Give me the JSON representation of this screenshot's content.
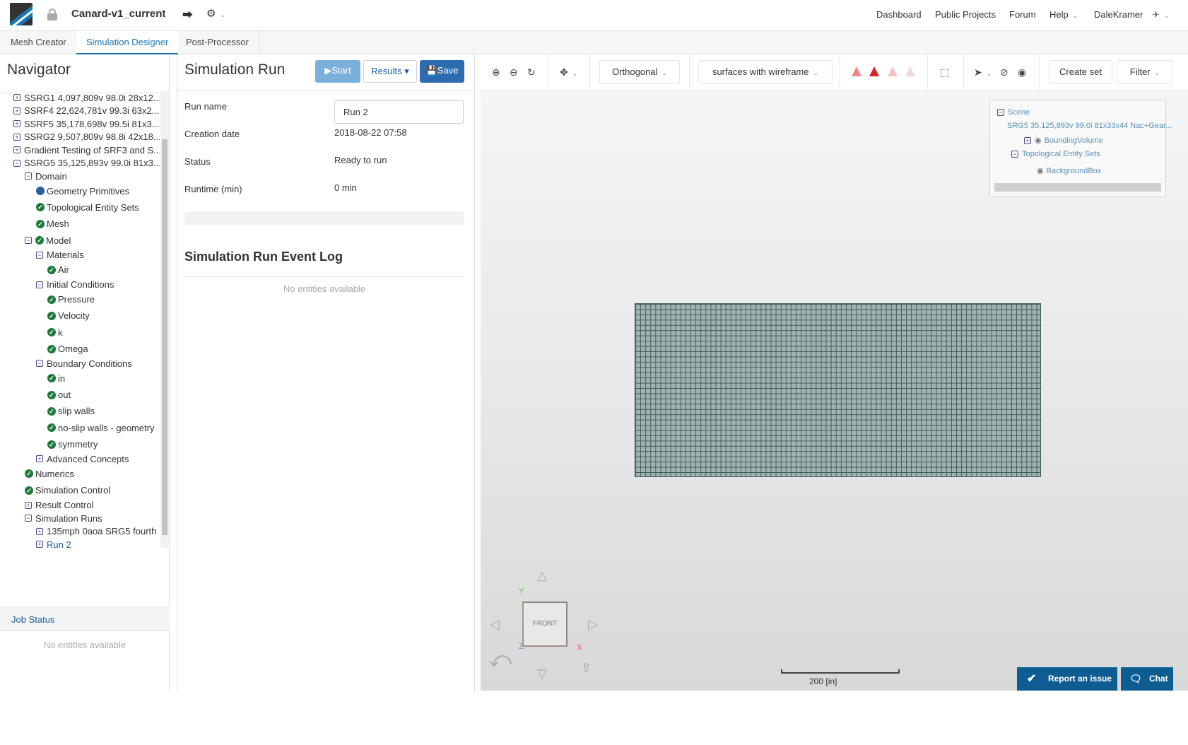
{
  "header": {
    "project_title": "Canard-v1_current",
    "nav": [
      "Dashboard",
      "Public Projects",
      "Forum",
      "Help",
      "DaleKramer"
    ]
  },
  "tabs": [
    "Mesh Creator",
    "Simulation Designer",
    "Post-Processor"
  ],
  "navigator": {
    "title": "Navigator",
    "tree": [
      {
        "label": "SSRG1 4,097,809v 98.0i 28x12...",
        "level": 0,
        "toggle": "+"
      },
      {
        "label": "SSRF4 22,624,781v 99.3i 63x2...",
        "level": 0,
        "toggle": "+"
      },
      {
        "label": "SSRF5 35,178,698v 99.5i 81x3...",
        "level": 0,
        "toggle": "+"
      },
      {
        "label": "SSRG2 9,507,809v 98.8i 42x18...",
        "level": 0,
        "toggle": "+"
      },
      {
        "label": "Gradient Testing of SRF3 and S...",
        "level": 0,
        "toggle": "+"
      },
      {
        "label": "SSRG5 35,125,893v 99.0i 81x3...",
        "level": 0,
        "toggle": "-"
      },
      {
        "label": "Domain",
        "level": 1,
        "toggle": "-"
      },
      {
        "label": "Geometry Primitives",
        "level": 2,
        "icon": "dot"
      },
      {
        "label": "Topological Entity Sets",
        "level": 2,
        "icon": "check"
      },
      {
        "label": "Mesh",
        "level": 2,
        "icon": "check"
      },
      {
        "label": "Model",
        "level": 1,
        "toggle": "-",
        "icon": "check"
      },
      {
        "label": "Materials",
        "level": 2,
        "toggle": "-"
      },
      {
        "label": "Air",
        "level": 3,
        "icon": "check"
      },
      {
        "label": "Initial Conditions",
        "level": 2,
        "toggle": "-"
      },
      {
        "label": "Pressure",
        "level": 3,
        "icon": "check"
      },
      {
        "label": "Velocity",
        "level": 3,
        "icon": "check"
      },
      {
        "label": "k",
        "level": 3,
        "icon": "check"
      },
      {
        "label": "Omega",
        "level": 3,
        "icon": "check"
      },
      {
        "label": "Boundary Conditions",
        "level": 2,
        "toggle": "-"
      },
      {
        "label": "in",
        "level": 3,
        "icon": "check"
      },
      {
        "label": "out",
        "level": 3,
        "icon": "check"
      },
      {
        "label": "slip walls",
        "level": 3,
        "icon": "check"
      },
      {
        "label": "no-slip walls - geometry",
        "level": 3,
        "icon": "check"
      },
      {
        "label": "symmetry",
        "level": 3,
        "icon": "check"
      },
      {
        "label": "Advanced Concepts",
        "level": 2,
        "toggle": "+"
      },
      {
        "label": "Numerics",
        "level": 1,
        "icon": "check"
      },
      {
        "label": "Simulation Control",
        "level": 1,
        "icon": "check"
      },
      {
        "label": "Result Control",
        "level": 1,
        "toggle": "+"
      },
      {
        "label": "Simulation Runs",
        "level": 1,
        "toggle": "-"
      },
      {
        "label": "135mph 0aoa SRG5 fourth",
        "level": 2,
        "toggle": "+"
      },
      {
        "label": "Run 2",
        "level": 2,
        "toggle": "+",
        "link": true
      }
    ]
  },
  "job_status": {
    "title": "Job Status",
    "empty": "No entities available"
  },
  "sim_run": {
    "title": "Simulation Run",
    "start": "Start",
    "results": "Results",
    "save": "Save",
    "fields": [
      {
        "label": "Run name",
        "value": "Run 2"
      },
      {
        "label": "Creation date",
        "value": "2018-08-22 07:58"
      },
      {
        "label": "Status",
        "value": "Ready to run"
      },
      {
        "label": "Runtime (min)",
        "value": "0 min"
      }
    ],
    "progress_percent": 0,
    "progress_label": "0%",
    "log_title": "Simulation Run Event Log",
    "log_empty": "No entities available"
  },
  "viewer": {
    "projection": "Orthogonal",
    "render_mode": "surfaces with wireframe",
    "create_set": "Create set",
    "filter": "Filter",
    "scene": {
      "root": "Scene",
      "model": "SRG5 35,125,893v 99.0i 81x33x44 Nac+Gear...",
      "bounding": "BoundingVolume",
      "tes": "Topological Entity Sets",
      "bgbox": "BackgroundBox"
    },
    "cube_face": "FRONT",
    "axis_x": "X",
    "axis_y": "Y",
    "axis_z": "Z",
    "scale_label": "200 [in]",
    "report": "Report an issue",
    "chat": "Chat"
  },
  "colors": {
    "accent": "#1a75b5",
    "check": "#1f7a3a",
    "button_dark": "#0d5d92",
    "mesh_fill": "#9fb3b3",
    "mesh_line": "#445a5a"
  }
}
